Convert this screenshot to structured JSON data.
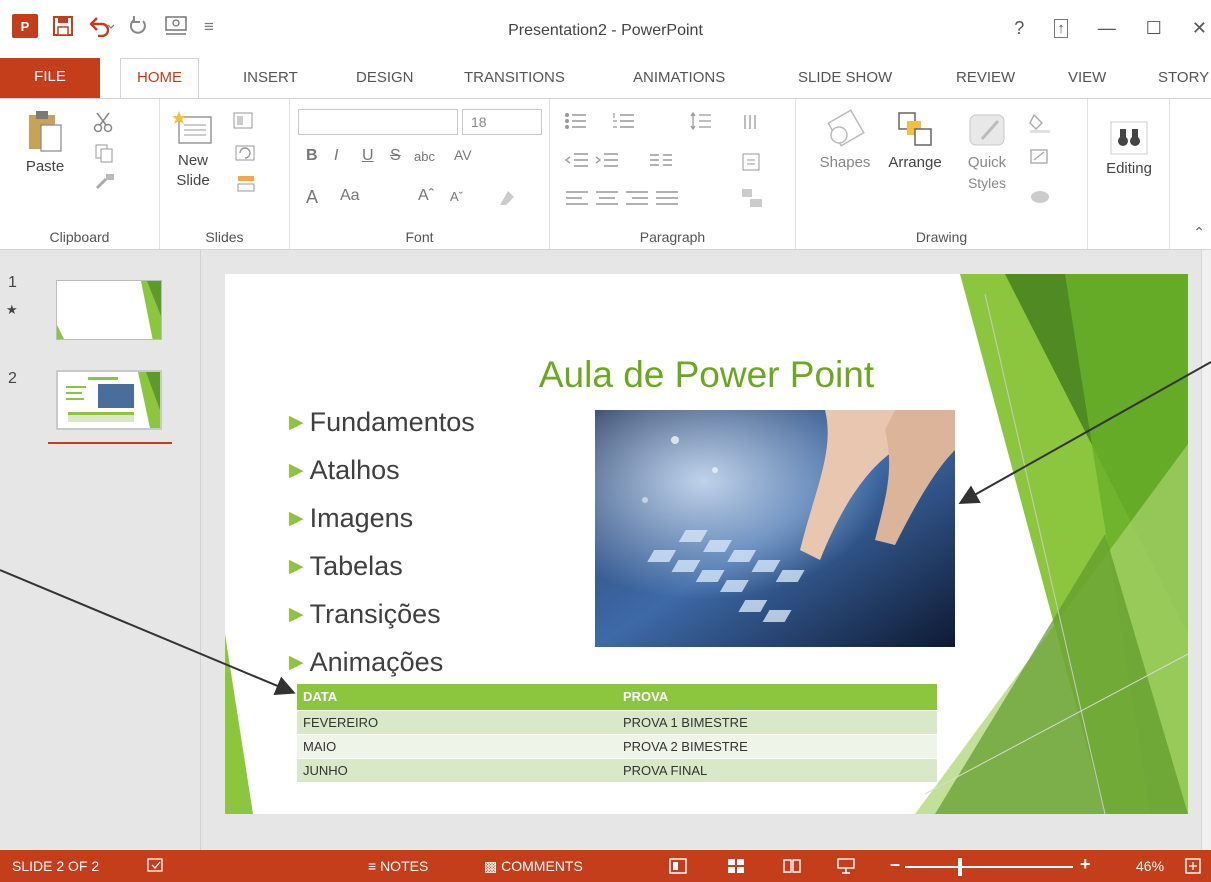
{
  "app": {
    "window_title": "Presentation2 - PowerPoint",
    "logo_text": "P",
    "controls": {
      "help": "?",
      "ribbon_options": "↑",
      "minimize": "—",
      "maximize": "☐",
      "close": "✕"
    }
  },
  "tabs": [
    "FILE",
    "HOME",
    "INSERT",
    "DESIGN",
    "TRANSITIONS",
    "ANIMATIONS",
    "SLIDE SHOW",
    "REVIEW",
    "VIEW",
    "STORY"
  ],
  "active_tab": "HOME",
  "ribbon": {
    "groups": {
      "clipboard": "Clipboard",
      "slides": "Slides",
      "font": "Font",
      "paragraph": "Paragraph",
      "drawing": "Drawing"
    },
    "paste": "Paste",
    "new_slide_line1": "New",
    "new_slide_line2": "Slide",
    "font_size": "18",
    "bold": "B",
    "italic": "I",
    "underline": "U",
    "strike": "S",
    "abc": "abc",
    "av": "AV",
    "font_color": "A",
    "change_case": "Aa",
    "grow": "Aˆ",
    "shrink": "Aˇ",
    "shapes": "Shapes",
    "arrange": "Arrange",
    "quick_line1": "Quick",
    "quick_line2": "Styles",
    "editing": "Editing"
  },
  "thumbnails": [
    {
      "number": "1",
      "marker": "★"
    },
    {
      "number": "2"
    }
  ],
  "slide": {
    "title": "Aula de Power Point",
    "bullets": [
      "Fundamentos",
      "Atalhos",
      "Imagens",
      "Tabelas",
      "Transições",
      "Animações"
    ],
    "table": {
      "headers": [
        "DATA",
        "PROVA"
      ],
      "rows": [
        [
          "FEVEREIRO",
          "PROVA 1 BIMESTRE"
        ],
        [
          "MAIO",
          "PROVA 2 BIMESTRE"
        ],
        [
          "JUNHO",
          "PROVA FINAL"
        ]
      ]
    }
  },
  "status": {
    "slide_counter": "SLIDE 2 OF 2",
    "notes": "NOTES",
    "comments": "COMMENTS",
    "zoom": "46%",
    "zoom_level": 0.46
  },
  "colors": {
    "accent": "#c43e1c",
    "slide_green": "#8cc63f",
    "title_green": "#6ba81f"
  },
  "icons": {
    "save": "save-icon",
    "undo": "undo-icon",
    "redo": "redo-icon",
    "start": "start-from-beginning-icon",
    "paste": "clipboard-icon",
    "new_slide": "new-slide-icon",
    "shapes": "shapes-icon",
    "arrange": "arrange-icon",
    "quick_styles": "quick-styles-icon",
    "find": "binoculars-icon"
  }
}
